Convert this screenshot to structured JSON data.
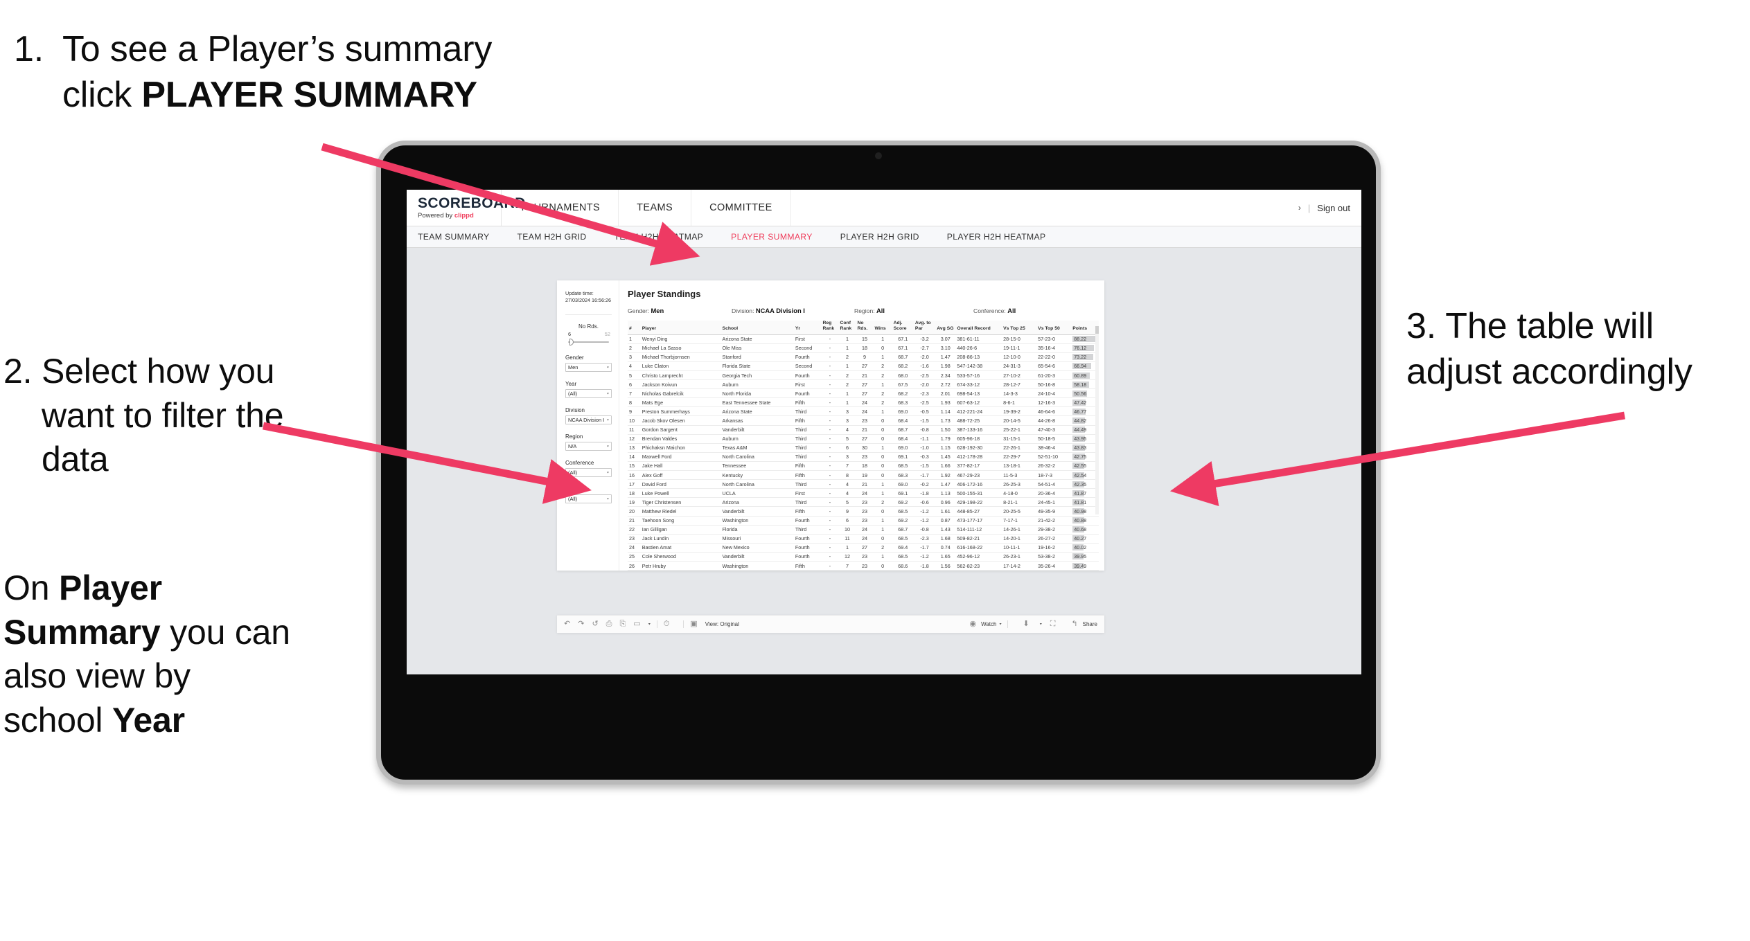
{
  "annotations": {
    "one": {
      "number": "1.",
      "text_before": "To see a Player’s summary click ",
      "bold": "PLAYER SUMMARY"
    },
    "two": {
      "number": "2.",
      "text": "Select how you want to filter the data"
    },
    "two_b": {
      "pre": "On ",
      "bold1": "Player Summary",
      "mid": " you can also view by school ",
      "bold2": "Year"
    },
    "three": {
      "number": "3.",
      "text": "The table will adjust accordingly"
    },
    "arrow_color": "#ee3a63"
  },
  "app": {
    "logo": {
      "main": "SCOREBOARD",
      "sub_prefix": "Powered by ",
      "sub_brand": "clippd"
    },
    "top_tabs": [
      {
        "label": "TOURNAMENTS"
      },
      {
        "label": "TEAMS"
      },
      {
        "label": "COMMITTEE"
      }
    ],
    "header_right": {
      "chevron": "›",
      "separator": "|",
      "sign_out": "Sign out"
    },
    "sub_tabs": [
      {
        "label": "TEAM SUMMARY",
        "active": false
      },
      {
        "label": "TEAM H2H GRID",
        "active": false
      },
      {
        "label": "TEAM H2H HEATMAP",
        "active": false
      },
      {
        "label": "PLAYER SUMMARY",
        "active": true
      },
      {
        "label": "PLAYER H2H GRID",
        "active": false
      },
      {
        "label": "PLAYER H2H HEATMAP",
        "active": false
      }
    ],
    "accent_color": "#ef3e5c"
  },
  "filters": {
    "update_label": "Update time:",
    "update_value": "27/03/2024 16:56:26",
    "slider": {
      "label": "No Rds.",
      "min": "6",
      "max": "52"
    },
    "groups": [
      {
        "label": "Gender",
        "value": "Men"
      },
      {
        "label": "Year",
        "value": "(All)"
      },
      {
        "label": "Division",
        "value": "NCAA Division I"
      },
      {
        "label": "Region",
        "value": "N/A"
      },
      {
        "label": "Conference",
        "value": "(All)"
      },
      {
        "label": "Player",
        "value": "(All)"
      }
    ],
    "caret": "▾"
  },
  "viz": {
    "title": "Player Standings",
    "subheads": [
      {
        "label": "Gender: ",
        "value": "Men"
      },
      {
        "label": "Division: ",
        "value": "NCAA Division I"
      },
      {
        "label": "Region: ",
        "value": "All"
      },
      {
        "label": "Conference: ",
        "value": "All"
      }
    ],
    "columns": [
      "#",
      "Player",
      "School",
      "Yr",
      "Reg Rank",
      "Conf Rank",
      "No Rds.",
      "Wins",
      "Adj. Score",
      "Avg. to Par",
      "Avg SG",
      "Overall Record",
      "Vs Top 25",
      "Vs Top 50",
      "Points"
    ],
    "rows": [
      {
        "n": "1",
        "player": "Wenyi Ding",
        "school": "Arizona State",
        "yr": "First",
        "reg": "-",
        "conf": "1",
        "rds": "15",
        "wins": "1",
        "adj": "67.1",
        "par": "-3.2",
        "sg": "3.07",
        "rec": "381-61-11",
        "t25": "28-15-0",
        "t50": "57-23-0",
        "pts": "88.22"
      },
      {
        "n": "2",
        "player": "Michael La Sasso",
        "school": "Ole Miss",
        "yr": "Second",
        "reg": "-",
        "conf": "1",
        "rds": "18",
        "wins": "0",
        "adj": "67.1",
        "par": "-2.7",
        "sg": "3.10",
        "rec": "440-26-6",
        "t25": "19-11-1",
        "t50": "35-16-4",
        "pts": "76.12"
      },
      {
        "n": "3",
        "player": "Michael Thorbjornsen",
        "school": "Stanford",
        "yr": "Fourth",
        "reg": "-",
        "conf": "2",
        "rds": "9",
        "wins": "1",
        "adj": "68.7",
        "par": "-2.0",
        "sg": "1.47",
        "rec": "208-86-13",
        "t25": "12-10-0",
        "t50": "22-22-0",
        "pts": "73.22"
      },
      {
        "n": "4",
        "player": "Luke Claton",
        "school": "Florida State",
        "yr": "Second",
        "reg": "-",
        "conf": "1",
        "rds": "27",
        "wins": "2",
        "adj": "68.2",
        "par": "-1.6",
        "sg": "1.98",
        "rec": "547-142-38",
        "t25": "24-31-3",
        "t50": "65-54-6",
        "pts": "66.94"
      },
      {
        "n": "5",
        "player": "Christo Lamprecht",
        "school": "Georgia Tech",
        "yr": "Fourth",
        "reg": "-",
        "conf": "2",
        "rds": "21",
        "wins": "2",
        "adj": "68.0",
        "par": "-2.5",
        "sg": "2.34",
        "rec": "533-57-16",
        "t25": "27-10-2",
        "t50": "61-20-3",
        "pts": "60.89"
      },
      {
        "n": "6",
        "player": "Jackson Koivun",
        "school": "Auburn",
        "yr": "First",
        "reg": "-",
        "conf": "2",
        "rds": "27",
        "wins": "1",
        "adj": "67.5",
        "par": "-2.0",
        "sg": "2.72",
        "rec": "674-33-12",
        "t25": "28-12-7",
        "t50": "50-16-8",
        "pts": "58.18"
      },
      {
        "n": "7",
        "player": "Nicholas Gabrelcik",
        "school": "North Florida",
        "yr": "Fourth",
        "reg": "-",
        "conf": "1",
        "rds": "27",
        "wins": "2",
        "adj": "68.2",
        "par": "-2.3",
        "sg": "2.01",
        "rec": "698-54-13",
        "t25": "14-3-3",
        "t50": "24-10-4",
        "pts": "50.56"
      },
      {
        "n": "8",
        "player": "Mats Ege",
        "school": "East Tennessee State",
        "yr": "Fifth",
        "reg": "-",
        "conf": "1",
        "rds": "24",
        "wins": "2",
        "adj": "68.3",
        "par": "-2.5",
        "sg": "1.93",
        "rec": "607-63-12",
        "t25": "8-6-1",
        "t50": "12-16-3",
        "pts": "47.42"
      },
      {
        "n": "9",
        "player": "Preston Summerhays",
        "school": "Arizona State",
        "yr": "Third",
        "reg": "-",
        "conf": "3",
        "rds": "24",
        "wins": "1",
        "adj": "69.0",
        "par": "-0.5",
        "sg": "1.14",
        "rec": "412-221-24",
        "t25": "19-39-2",
        "t50": "46-64-6",
        "pts": "46.77"
      },
      {
        "n": "10",
        "player": "Jacob Skov Olesen",
        "school": "Arkansas",
        "yr": "Fifth",
        "reg": "-",
        "conf": "3",
        "rds": "23",
        "wins": "0",
        "adj": "68.4",
        "par": "-1.5",
        "sg": "1.73",
        "rec": "488-72-25",
        "t25": "20-14-5",
        "t50": "44-26-8",
        "pts": "44.82"
      },
      {
        "n": "11",
        "player": "Gordon Sargent",
        "school": "Vanderbilt",
        "yr": "Third",
        "reg": "-",
        "conf": "4",
        "rds": "21",
        "wins": "0",
        "adj": "68.7",
        "par": "-0.8",
        "sg": "1.50",
        "rec": "387-133-16",
        "t25": "25-22-1",
        "t50": "47-40-3",
        "pts": "44.49"
      },
      {
        "n": "12",
        "player": "Brendan Valdes",
        "school": "Auburn",
        "yr": "Third",
        "reg": "-",
        "conf": "5",
        "rds": "27",
        "wins": "0",
        "adj": "68.4",
        "par": "-1.1",
        "sg": "1.79",
        "rec": "605-96-18",
        "t25": "31-15-1",
        "t50": "50-18-5",
        "pts": "43.95"
      },
      {
        "n": "13",
        "player": "Phichaksn Maichon",
        "school": "Texas A&M",
        "yr": "Third",
        "reg": "-",
        "conf": "6",
        "rds": "30",
        "wins": "1",
        "adj": "69.0",
        "par": "-1.0",
        "sg": "1.15",
        "rec": "628-192-30",
        "t25": "22-26-1",
        "t50": "38-46-4",
        "pts": "43.83"
      },
      {
        "n": "14",
        "player": "Maxwell Ford",
        "school": "North Carolina",
        "yr": "Third",
        "reg": "-",
        "conf": "3",
        "rds": "23",
        "wins": "0",
        "adj": "69.1",
        "par": "-0.3",
        "sg": "1.45",
        "rec": "412-178-28",
        "t25": "22-29-7",
        "t50": "52-51-10",
        "pts": "42.75"
      },
      {
        "n": "15",
        "player": "Jake Hall",
        "school": "Tennessee",
        "yr": "Fifth",
        "reg": "-",
        "conf": "7",
        "rds": "18",
        "wins": "0",
        "adj": "68.5",
        "par": "-1.5",
        "sg": "1.66",
        "rec": "377-82-17",
        "t25": "13-18-1",
        "t50": "26-32-2",
        "pts": "42.55"
      },
      {
        "n": "16",
        "player": "Alex Goff",
        "school": "Kentucky",
        "yr": "Fifth",
        "reg": "-",
        "conf": "8",
        "rds": "19",
        "wins": "0",
        "adj": "68.3",
        "par": "-1.7",
        "sg": "1.92",
        "rec": "467-29-23",
        "t25": "11-5-3",
        "t50": "18-7-3",
        "pts": "42.54"
      },
      {
        "n": "17",
        "player": "David Ford",
        "school": "North Carolina",
        "yr": "Third",
        "reg": "-",
        "conf": "4",
        "rds": "21",
        "wins": "1",
        "adj": "69.0",
        "par": "-0.2",
        "sg": "1.47",
        "rec": "406-172-16",
        "t25": "26-25-3",
        "t50": "54-51-4",
        "pts": "42.35"
      },
      {
        "n": "18",
        "player": "Luke Powell",
        "school": "UCLA",
        "yr": "First",
        "reg": "-",
        "conf": "4",
        "rds": "24",
        "wins": "1",
        "adj": "69.1",
        "par": "-1.8",
        "sg": "1.13",
        "rec": "500-155-31",
        "t25": "4-18-0",
        "t50": "20-36-4",
        "pts": "41.87"
      },
      {
        "n": "19",
        "player": "Tiger Christensen",
        "school": "Arizona",
        "yr": "Third",
        "reg": "-",
        "conf": "5",
        "rds": "23",
        "wins": "2",
        "adj": "69.2",
        "par": "-0.6",
        "sg": "0.96",
        "rec": "429-198-22",
        "t25": "8-21-1",
        "t50": "24-45-1",
        "pts": "41.81"
      },
      {
        "n": "20",
        "player": "Matthew Riedel",
        "school": "Vanderbilt",
        "yr": "Fifth",
        "reg": "-",
        "conf": "9",
        "rds": "23",
        "wins": "0",
        "adj": "68.5",
        "par": "-1.2",
        "sg": "1.61",
        "rec": "448-85-27",
        "t25": "20-25-5",
        "t50": "49-35-9",
        "pts": "40.98"
      },
      {
        "n": "21",
        "player": "Taehoon Song",
        "school": "Washington",
        "yr": "Fourth",
        "reg": "-",
        "conf": "6",
        "rds": "23",
        "wins": "1",
        "adj": "69.2",
        "par": "-1.2",
        "sg": "0.87",
        "rec": "473-177-17",
        "t25": "7-17-1",
        "t50": "21-42-2",
        "pts": "40.88"
      },
      {
        "n": "22",
        "player": "Ian Gilligan",
        "school": "Florida",
        "yr": "Third",
        "reg": "-",
        "conf": "10",
        "rds": "24",
        "wins": "1",
        "adj": "68.7",
        "par": "-0.8",
        "sg": "1.43",
        "rec": "514-111-12",
        "t25": "14-26-1",
        "t50": "29-38-2",
        "pts": "40.68"
      },
      {
        "n": "23",
        "player": "Jack Lundin",
        "school": "Missouri",
        "yr": "Fourth",
        "reg": "-",
        "conf": "11",
        "rds": "24",
        "wins": "0",
        "adj": "68.5",
        "par": "-2.3",
        "sg": "1.68",
        "rec": "509-82-21",
        "t25": "14-20-1",
        "t50": "26-27-2",
        "pts": "40.27"
      },
      {
        "n": "24",
        "player": "Bastien Amat",
        "school": "New Mexico",
        "yr": "Fourth",
        "reg": "-",
        "conf": "1",
        "rds": "27",
        "wins": "2",
        "adj": "69.4",
        "par": "-1.7",
        "sg": "0.74",
        "rec": "616-168-22",
        "t25": "10-11-1",
        "t50": "19-16-2",
        "pts": "40.02"
      },
      {
        "n": "25",
        "player": "Cole Sherwood",
        "school": "Vanderbilt",
        "yr": "Fourth",
        "reg": "-",
        "conf": "12",
        "rds": "23",
        "wins": "1",
        "adj": "68.5",
        "par": "-1.2",
        "sg": "1.65",
        "rec": "452-96-12",
        "t25": "26-23-1",
        "t50": "53-38-2",
        "pts": "39.95"
      },
      {
        "n": "26",
        "player": "Petr Hruby",
        "school": "Washington",
        "yr": "Fifth",
        "reg": "-",
        "conf": "7",
        "rds": "23",
        "wins": "0",
        "adj": "68.6",
        "par": "-1.8",
        "sg": "1.56",
        "rec": "562-82-23",
        "t25": "17-14-2",
        "t50": "35-26-4",
        "pts": "39.49"
      }
    ]
  },
  "toolbar": {
    "view_label": "View: Original",
    "watch_label": "Watch",
    "share_label": "Share",
    "caret": "▾"
  },
  "chart_data": {
    "type": "table",
    "title": "Player Standings",
    "columns": [
      "#",
      "Player",
      "School",
      "Yr",
      "Reg Rank",
      "Conf Rank",
      "No Rds.",
      "Wins",
      "Adj. Score",
      "Avg. to Par",
      "Avg SG",
      "Overall Record",
      "Vs Top 25",
      "Vs Top 50",
      "Points"
    ],
    "points_series": {
      "name": "Points",
      "categories": [
        "Wenyi Ding",
        "Michael La Sasso",
        "Michael Thorbjornsen",
        "Luke Claton",
        "Christo Lamprecht",
        "Jackson Koivun",
        "Nicholas Gabrelcik",
        "Mats Ege",
        "Preston Summerhays",
        "Jacob Skov Olesen",
        "Gordon Sargent",
        "Brendan Valdes",
        "Phichaksn Maichon",
        "Maxwell Ford",
        "Jake Hall",
        "Alex Goff",
        "David Ford",
        "Luke Powell",
        "Tiger Christensen",
        "Matthew Riedel",
        "Taehoon Song",
        "Ian Gilligan",
        "Jack Lundin",
        "Bastien Amat",
        "Cole Sherwood",
        "Petr Hruby"
      ],
      "values": [
        88.22,
        76.12,
        73.22,
        66.94,
        60.89,
        58.18,
        50.56,
        47.42,
        46.77,
        44.82,
        44.49,
        43.95,
        43.83,
        42.75,
        42.55,
        42.54,
        42.35,
        41.87,
        41.81,
        40.98,
        40.88,
        40.68,
        40.27,
        40.02,
        39.95,
        39.49
      ],
      "ylim": [
        0,
        88.22
      ]
    }
  }
}
